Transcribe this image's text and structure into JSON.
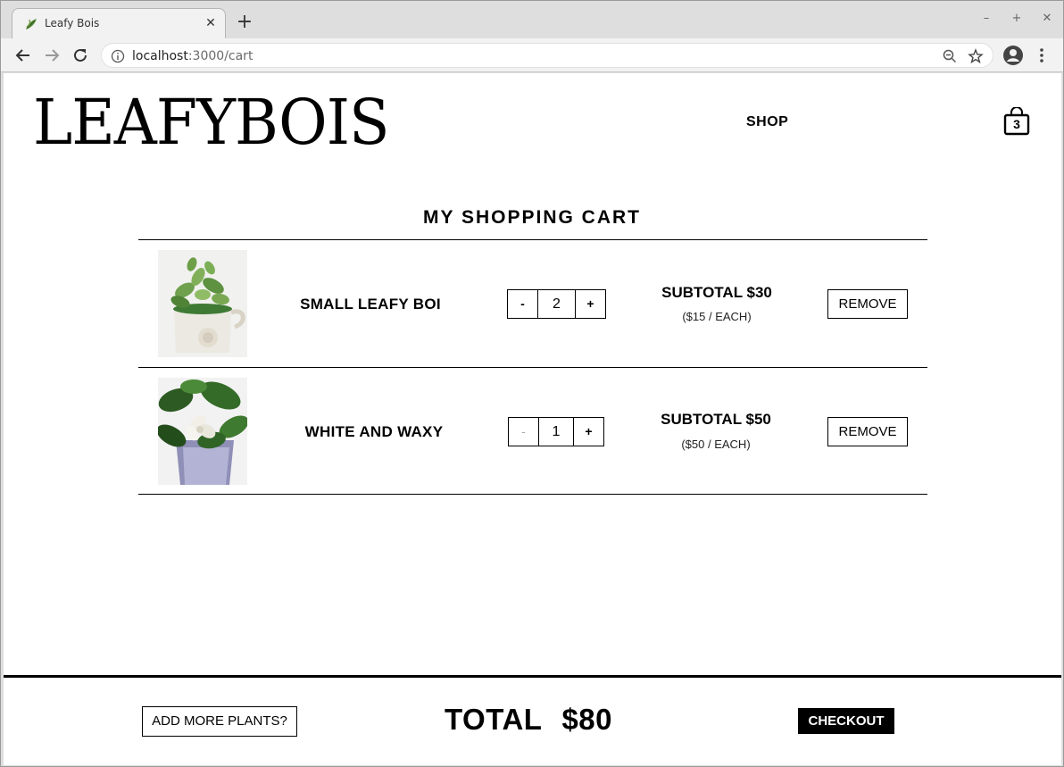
{
  "browser": {
    "tab_title": "Leafy Bois",
    "url_host": "localhost",
    "url_path": ":3000/cart",
    "new_tab_icon": "plus-icon",
    "tab_close_icon": "close-icon"
  },
  "header": {
    "logo": "LEAFYBOIS",
    "nav_shop": "SHOP",
    "cart_count": "3"
  },
  "cart": {
    "title": "MY SHOPPING CART",
    "items": [
      {
        "name": "SMALL LEAFY BOI",
        "quantity": "2",
        "minus": "-",
        "plus": "+",
        "subtotal": "SUBTOTAL $30",
        "each": "($15 / EACH)",
        "remove": "REMOVE"
      },
      {
        "name": "WHITE AND WAXY",
        "quantity": "1",
        "minus": "-",
        "plus": "+",
        "subtotal": "SUBTOTAL $50",
        "each": "($50 / EACH)",
        "remove": "REMOVE"
      }
    ]
  },
  "footer": {
    "add_more": "ADD MORE PLANTS?",
    "total_label": "TOTAL",
    "total_amount": "$80",
    "checkout": "CHECKOUT"
  }
}
